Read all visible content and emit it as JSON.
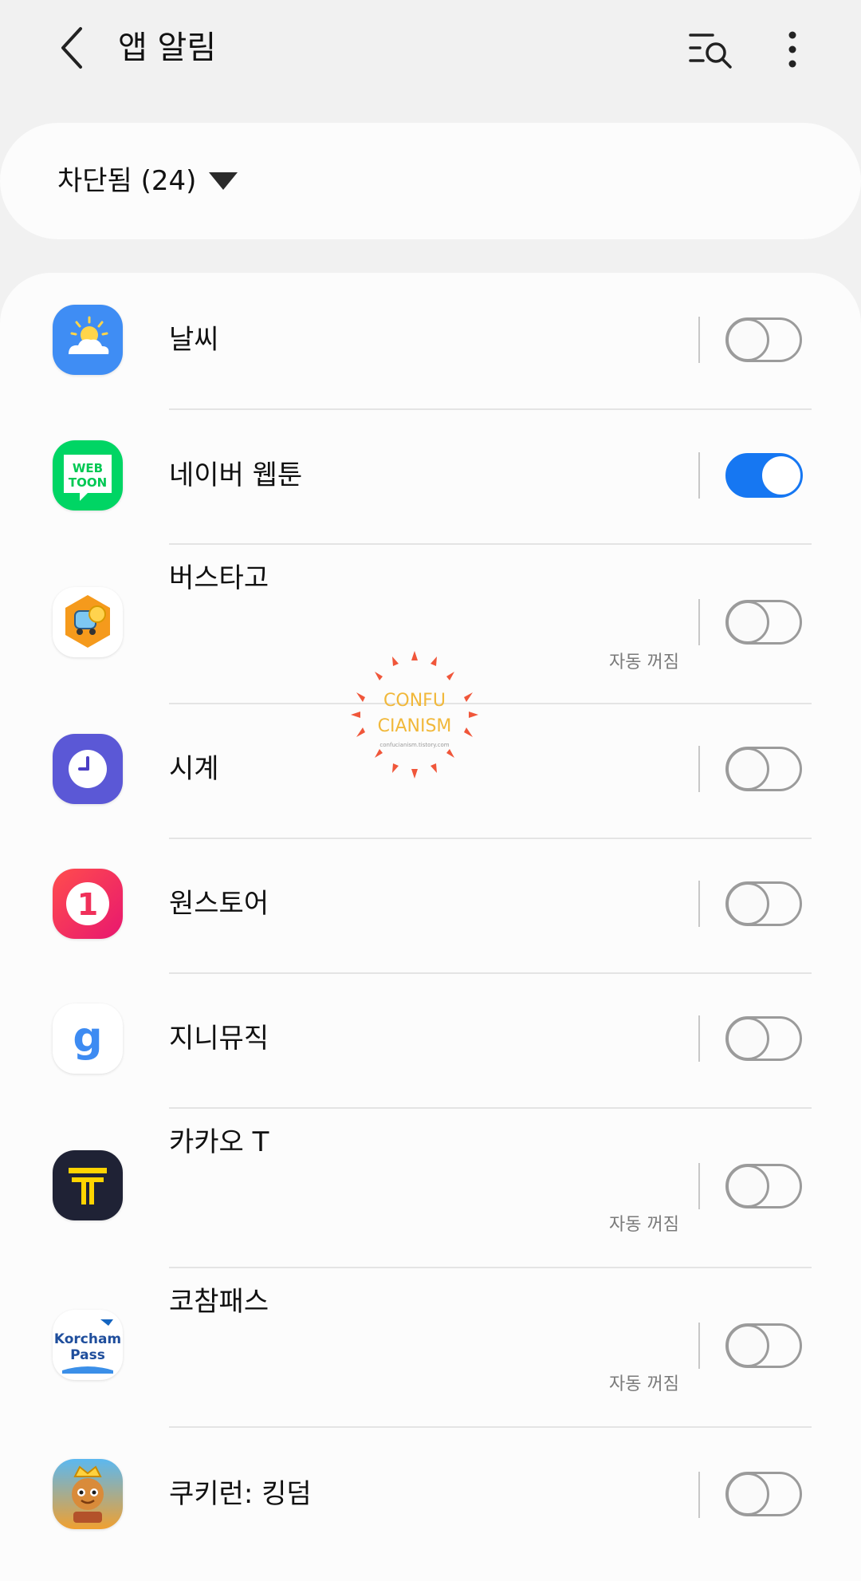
{
  "header": {
    "title": "앱 알림",
    "back_icon": "chevron-left-icon",
    "search_icon": "list-search-icon",
    "more_icon": "more-vertical-icon"
  },
  "filter": {
    "label": "차단됨 (24)",
    "caret_icon": "caret-down-icon"
  },
  "apps": [
    {
      "name": "날씨",
      "icon": "weather-icon",
      "toggle_on": false,
      "auto_off": ""
    },
    {
      "name": "네이버 웹툰",
      "icon": "webtoon-icon",
      "icon_text": "WEB TOON",
      "toggle_on": true,
      "auto_off": ""
    },
    {
      "name": "버스타고",
      "icon": "bustago-icon",
      "toggle_on": false,
      "auto_off": "자동 꺼짐"
    },
    {
      "name": "시계",
      "icon": "clock-icon",
      "toggle_on": false,
      "auto_off": ""
    },
    {
      "name": "원스토어",
      "icon": "onestore-icon",
      "icon_text": "1",
      "toggle_on": false,
      "auto_off": ""
    },
    {
      "name": "지니뮤직",
      "icon": "genie-music-icon",
      "icon_text": "g",
      "toggle_on": false,
      "auto_off": ""
    },
    {
      "name": "카카오 T",
      "icon": "kakao-t-icon",
      "toggle_on": false,
      "auto_off": "자동 꺼짐"
    },
    {
      "name": "코참패스",
      "icon": "korcham-pass-icon",
      "icon_text_1": "Korcham",
      "icon_text_2": "Pass",
      "toggle_on": false,
      "auto_off": "자동 꺼짐"
    },
    {
      "name": "쿠키런: 킹덤",
      "icon": "cookierun-kingdom-icon",
      "toggle_on": false,
      "auto_off": ""
    }
  ],
  "watermark": {
    "line1": "CONFU",
    "line2": "CIANISM",
    "line3": "confucianism.tistory.com"
  },
  "colors": {
    "background": "#f1f1f1",
    "card": "#fcfcfc",
    "toggle_on": "#1677f2",
    "toggle_off": "#9b9b9b"
  }
}
